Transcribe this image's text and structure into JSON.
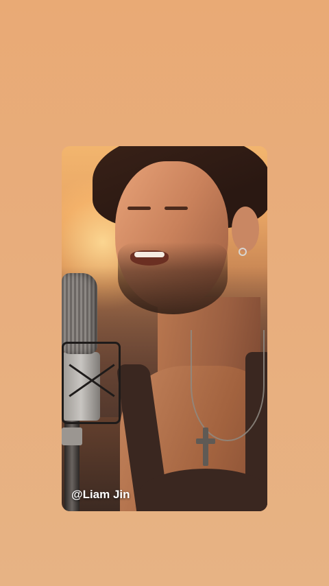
{
  "video": {
    "creator_handle": "@Liam Jin"
  },
  "colors": {
    "background": "#e8ad7c",
    "handle_text": "#ffffff"
  }
}
